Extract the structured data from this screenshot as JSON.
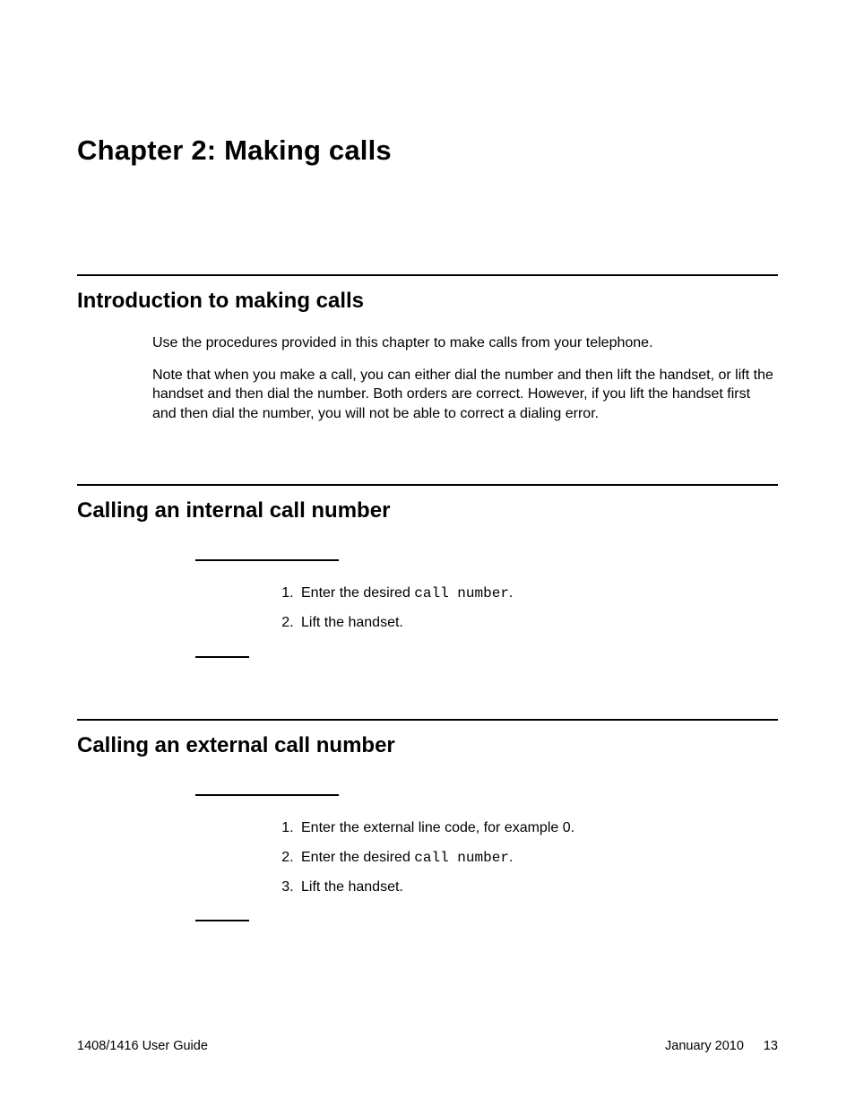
{
  "chapter": {
    "title": "Chapter 2:  Making calls"
  },
  "sections": {
    "intro": {
      "title": "Introduction to making calls",
      "p1": "Use the procedures provided in this chapter to make calls from your telephone.",
      "p2": "Note that when you make a call, you can either dial the number and then lift the handset, or lift the handset and then dial the number. Both orders are correct. However, if you lift the handset first and then dial the number, you will not be able to correct a dialing error."
    },
    "internal": {
      "title": "Calling an internal call number",
      "step1_prefix": "Enter the desired ",
      "step1_code": "call number",
      "step1_suffix": ".",
      "step2": "Lift the handset."
    },
    "external": {
      "title": "Calling an external call number",
      "step1": "Enter the external line code, for example 0.",
      "step2_prefix": "Enter the desired ",
      "step2_code": "call number",
      "step2_suffix": ".",
      "step3": "Lift the handset."
    }
  },
  "footer": {
    "guide": "1408/1416 User Guide",
    "date": "January 2010",
    "page": "13"
  }
}
